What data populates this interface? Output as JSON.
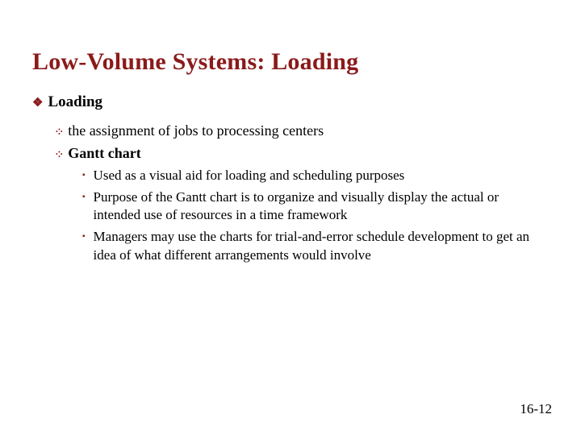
{
  "title": "Low-Volume Systems: Loading",
  "h1": "Loading",
  "b1": "the assignment of jobs to processing centers",
  "b2": "Gantt chart",
  "s1": "Used as a visual aid for loading and scheduling purposes",
  "s2": "Purpose of the Gantt chart is to organize and visually display the actual or intended use of resources in a time framework",
  "s3": "Managers may use the charts for trial-and-error schedule development to get an idea of what different arrangements would involve",
  "page": "16-12"
}
